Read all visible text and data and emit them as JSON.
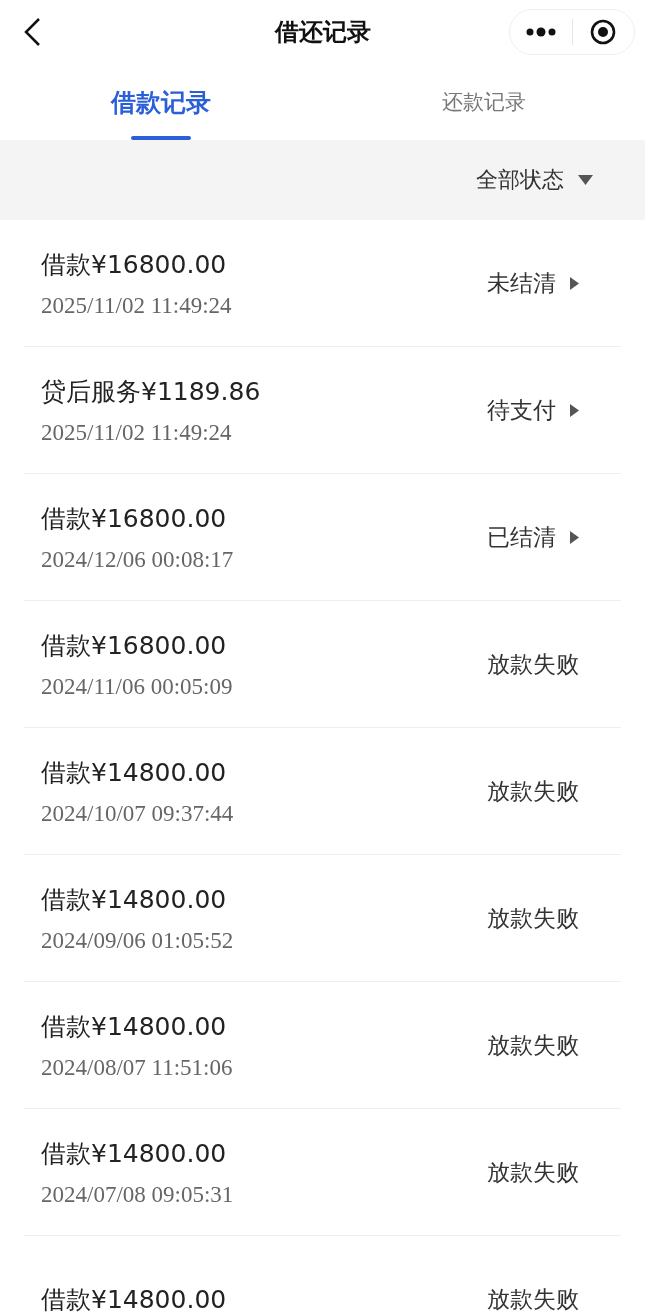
{
  "nav": {
    "title": "借还记录"
  },
  "tabs": [
    {
      "label": "借款记录",
      "selected": true
    },
    {
      "label": "还款记录",
      "selected": false
    }
  ],
  "filter": {
    "label": "全部状态"
  },
  "records": [
    {
      "title": "借款¥16800.00",
      "date": "2025/11/02 11:49:24",
      "status": "未结清",
      "kind": "detail"
    },
    {
      "title": "贷后服务¥1189.86",
      "date": "2025/11/02 11:49:24",
      "status": "待支付",
      "kind": "detail"
    },
    {
      "title": "借款¥16800.00",
      "date": "2024/12/06 00:08:17",
      "status": "已结清",
      "kind": "detail"
    },
    {
      "title": "借款¥16800.00",
      "date": "2024/11/06 00:05:09",
      "status": "放款失败",
      "kind": "plain"
    },
    {
      "title": "借款¥14800.00",
      "date": "2024/10/07 09:37:44",
      "status": "放款失败",
      "kind": "plain"
    },
    {
      "title": "借款¥14800.00",
      "date": "2024/09/06 01:05:52",
      "status": "放款失败",
      "kind": "plain"
    },
    {
      "title": "借款¥14800.00",
      "date": "2024/08/07 11:51:06",
      "status": "放款失败",
      "kind": "plain"
    },
    {
      "title": "借款¥14800.00",
      "date": "2024/07/08 09:05:31",
      "status": "放款失败",
      "kind": "plain"
    },
    {
      "title": "借款¥14800.00",
      "status": "放款失败",
      "kind": "plain"
    }
  ]
}
